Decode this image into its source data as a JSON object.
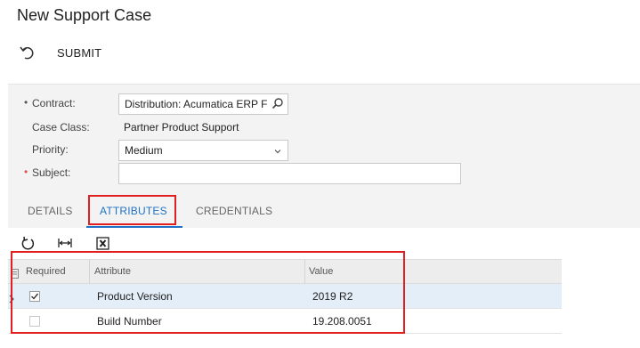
{
  "page": {
    "title": "New Support Case"
  },
  "toolbar": {
    "undo_icon": "undo-icon",
    "submit_label": "SUBMIT"
  },
  "form": {
    "contract": {
      "label": "Contract:",
      "value": "Distribution: Acumatica ERP F",
      "icon": "search-icon"
    },
    "case_class": {
      "label": "Case Class:",
      "value": "Partner Product Support"
    },
    "priority": {
      "label": "Priority:",
      "value": "Medium",
      "icon": "chevron-down-icon"
    },
    "subject": {
      "label": "Subject:",
      "value": ""
    }
  },
  "tabs": [
    {
      "label": "DETAILS",
      "active": false
    },
    {
      "label": "ATTRIBUTES",
      "active": true
    },
    {
      "label": "CREDENTIALS",
      "active": false
    }
  ],
  "grid_toolbar": {
    "icons": [
      "refresh-icon",
      "fit-columns-icon",
      "export-excel-icon"
    ]
  },
  "grid": {
    "columns": [
      "Required",
      "Attribute",
      "Value"
    ],
    "rows": [
      {
        "required": true,
        "attribute": "Product Version",
        "value": "2019 R2"
      },
      {
        "required": false,
        "attribute": "Build Number",
        "value": "19.208.0051"
      }
    ]
  },
  "colors": {
    "accent": "#1f72c5",
    "highlight": "#e02020",
    "required_marker": "#e05050",
    "panel_bg": "#f3f3f3",
    "selected_row": "#e3eef8"
  }
}
